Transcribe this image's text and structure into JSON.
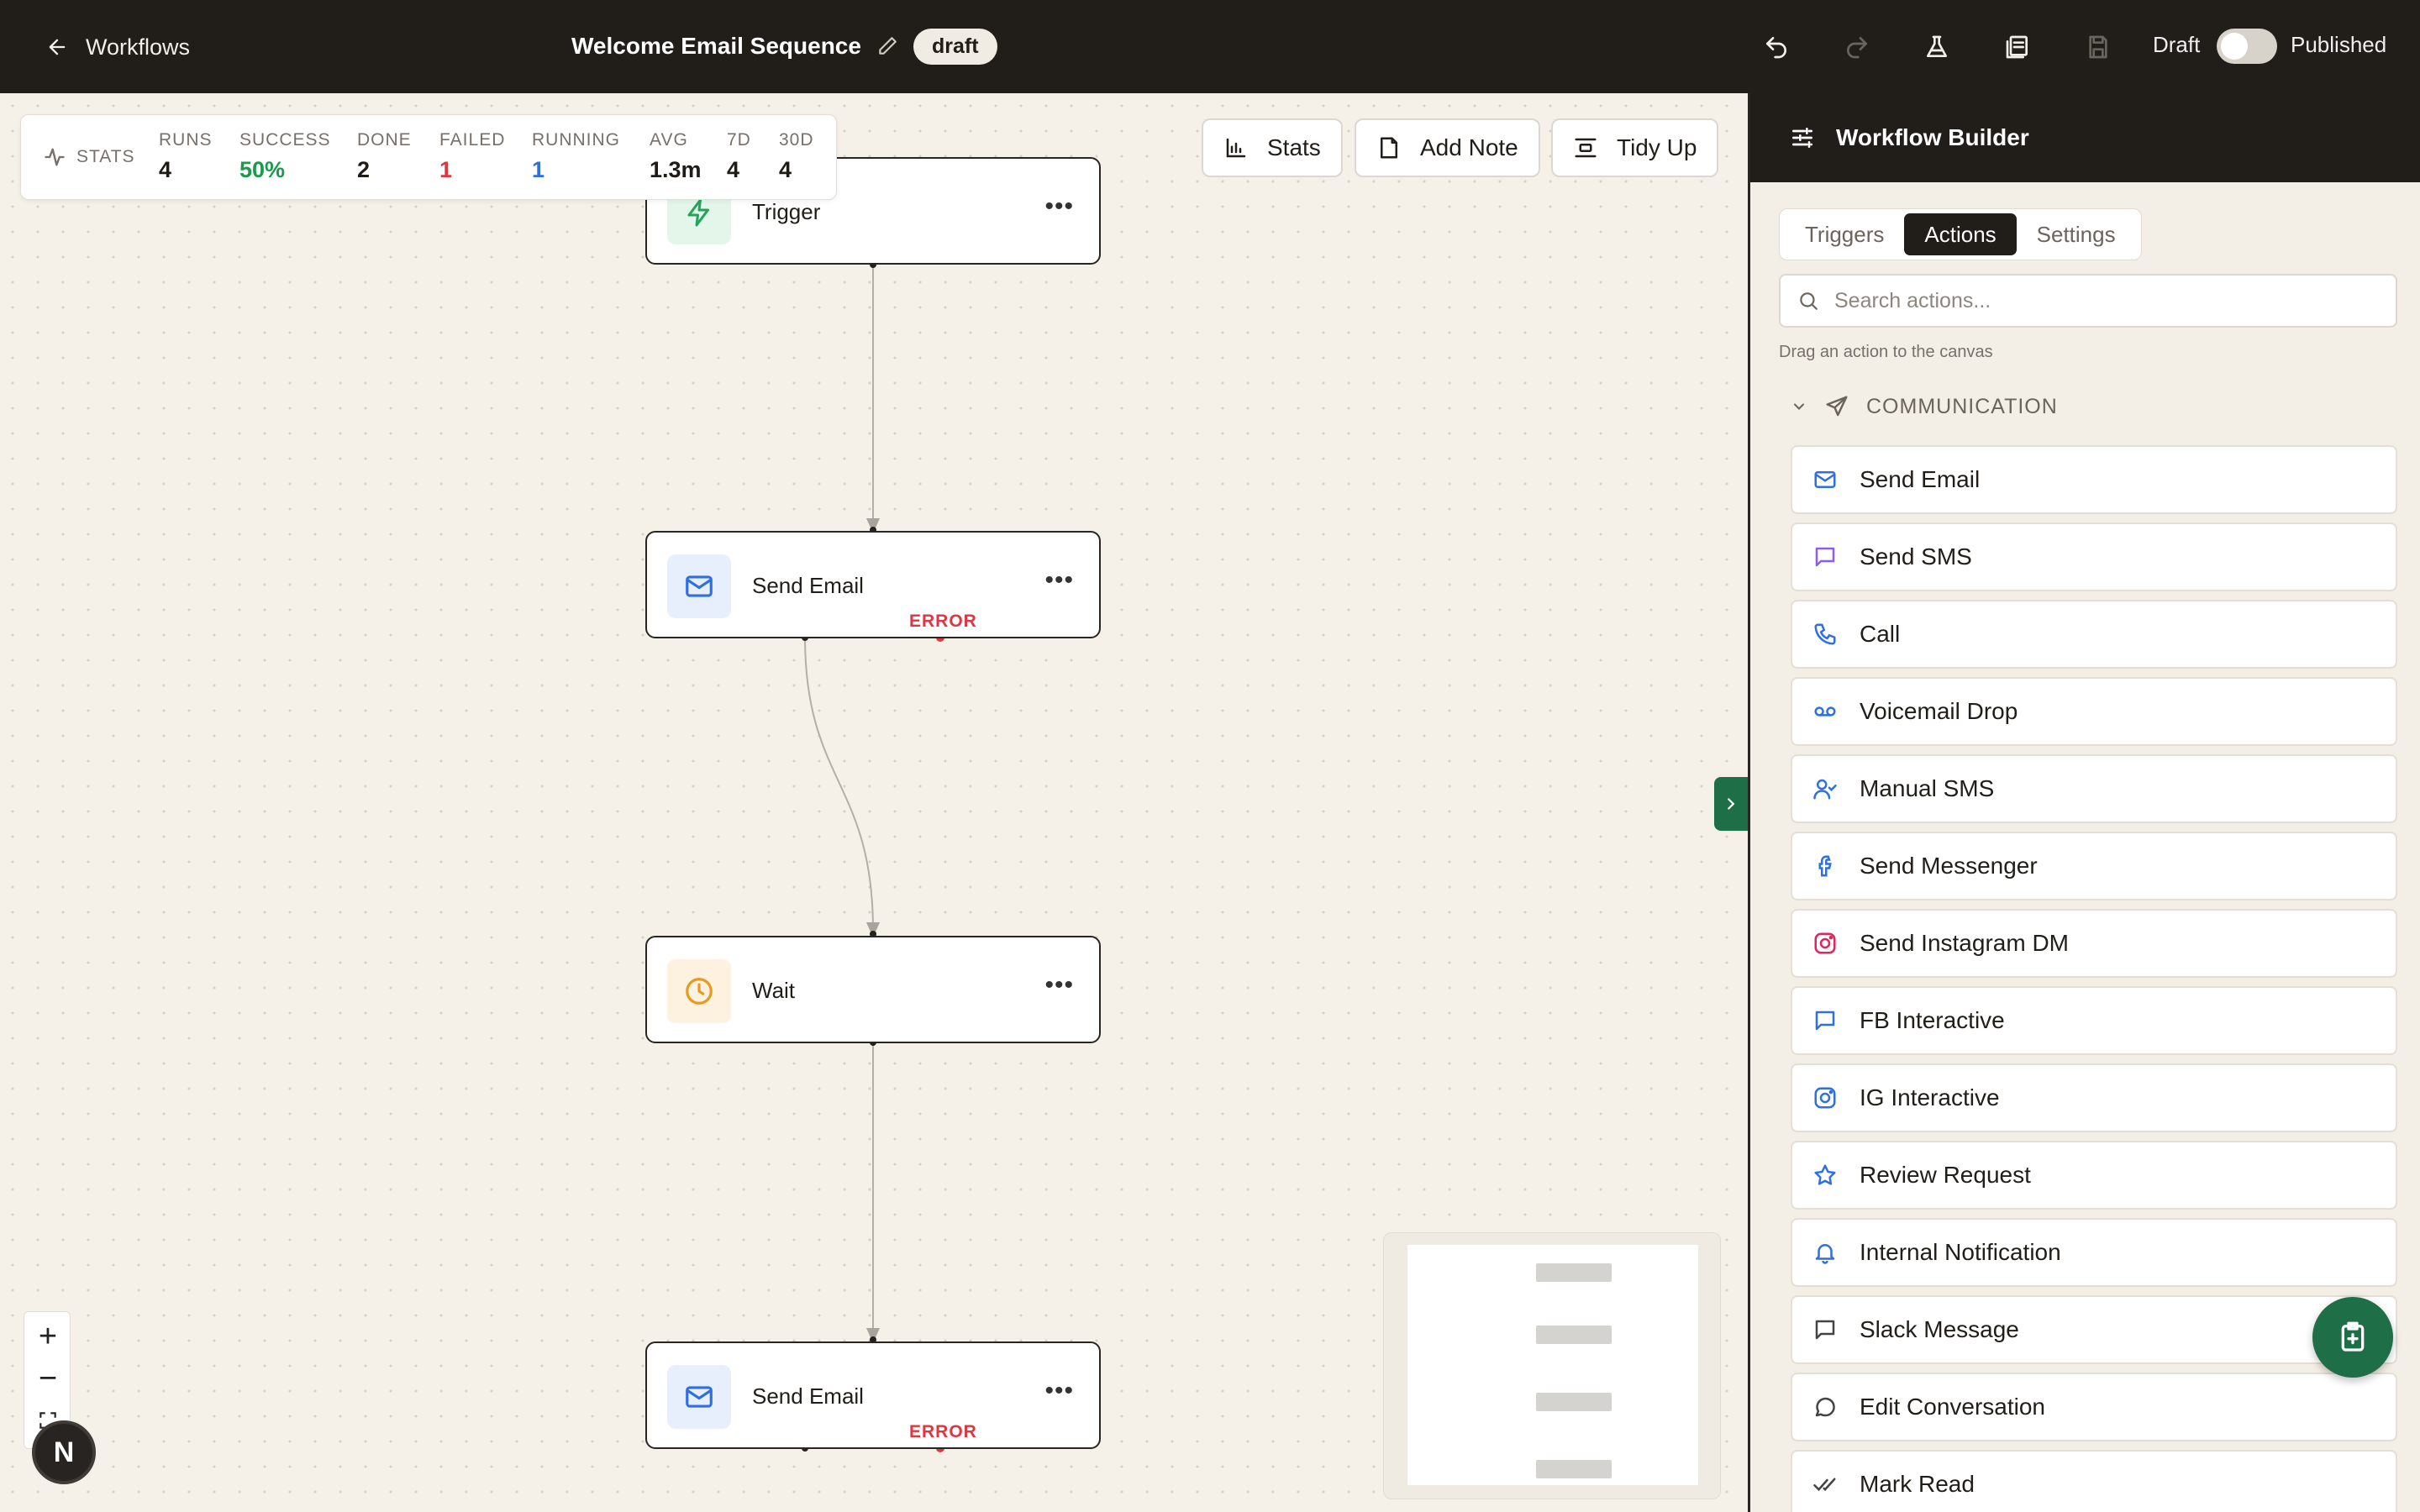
{
  "topbar": {
    "back_label": "Workflows",
    "title": "Welcome Email Sequence",
    "status_badge": "draft",
    "draft_label": "Draft",
    "published_label": "Published",
    "is_published": false
  },
  "stats": {
    "header": "STATS",
    "items": [
      {
        "label": "RUNS",
        "value": "4",
        "color": "#1f1b17"
      },
      {
        "label": "SUCCESS",
        "value": "50%",
        "color": "#1a9a4c"
      },
      {
        "label": "DONE",
        "value": "2",
        "color": "#1f1b17"
      },
      {
        "label": "FAILED",
        "value": "1",
        "color": "#e0363f"
      },
      {
        "label": "RUNNING",
        "value": "1",
        "color": "#2f6fe0"
      },
      {
        "label": "AVG",
        "value": "1.3m",
        "color": "#1f1b17"
      },
      {
        "label": "7D",
        "value": "4",
        "color": "#1f1b17"
      },
      {
        "label": "30D",
        "value": "4",
        "color": "#1f1b17"
      }
    ]
  },
  "canvas_toolbar": {
    "stats_label": "Stats",
    "add_note_label": "Add Note",
    "tidy_up_label": "Tidy Up"
  },
  "nodes": [
    {
      "label": "Trigger",
      "icon": "lightning-icon",
      "error": ""
    },
    {
      "label": "Send Email",
      "icon": "mail-icon",
      "error": "ERROR"
    },
    {
      "label": "Wait",
      "icon": "clock-icon",
      "error": ""
    },
    {
      "label": "Send Email",
      "icon": "mail-icon",
      "error": "ERROR"
    }
  ],
  "sidebar": {
    "title": "Workflow Builder",
    "tabs": [
      {
        "label": "Triggers",
        "active": false
      },
      {
        "label": "Actions",
        "active": true
      },
      {
        "label": "Settings",
        "active": false
      }
    ],
    "search_placeholder": "Search actions...",
    "hint": "Drag an action to the canvas",
    "category": "COMMUNICATION",
    "actions": [
      {
        "label": "Send Email",
        "icon": "mail-icon"
      },
      {
        "label": "Send SMS",
        "icon": "chat-bubble-icon"
      },
      {
        "label": "Call",
        "icon": "phone-icon"
      },
      {
        "label": "Voicemail Drop",
        "icon": "voicemail-icon"
      },
      {
        "label": "Manual SMS",
        "icon": "user-check-icon"
      },
      {
        "label": "Send Messenger",
        "icon": "facebook-icon"
      },
      {
        "label": "Send Instagram DM",
        "icon": "instagram-icon"
      },
      {
        "label": "FB Interactive",
        "icon": "chat-square-icon"
      },
      {
        "label": "IG Interactive",
        "icon": "instagram-icon"
      },
      {
        "label": "Review Request",
        "icon": "star-icon"
      },
      {
        "label": "Internal Notification",
        "icon": "bell-icon"
      },
      {
        "label": "Slack Message",
        "icon": "message-square-icon"
      },
      {
        "label": "Edit Conversation",
        "icon": "message-circle-icon"
      },
      {
        "label": "Mark Read",
        "icon": "double-check-icon"
      }
    ]
  },
  "colors": {
    "accent_green": "#1e6e47",
    "dark": "#211d19",
    "error_red": "#e0363f",
    "success_green": "#1a9a4c",
    "running_blue": "#2f6fe0"
  }
}
